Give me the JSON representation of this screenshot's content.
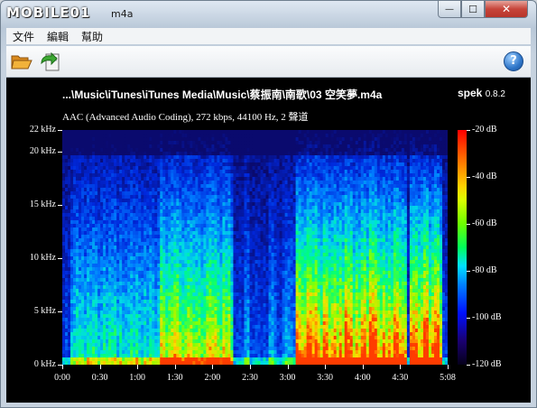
{
  "window": {
    "title_logo": "MOBILE01",
    "title": "m4a",
    "min_glyph": "—",
    "max_glyph": "☐",
    "close_glyph": "✕"
  },
  "menu": [
    "文件",
    "編輯",
    "幫助"
  ],
  "toolbar": {
    "open_icon": "folder-open-icon",
    "save_icon": "save-export-icon",
    "help_icon": "help-icon",
    "help_glyph": "?"
  },
  "spek": {
    "file_path": "...\\Music\\iTunes\\iTunes Media\\Music\\蔡振南\\南歌\\03 空笑夢.m4a",
    "app_name": "spek",
    "version": "0.8.2",
    "file_info": "AAC (Advanced Audio Coding), 272 kbps, 44100 Hz, 2 聲道"
  },
  "chart_data": {
    "type": "heatmap",
    "x_ticks": [
      "0:00",
      "0:30",
      "1:00",
      "1:30",
      "2:00",
      "2:30",
      "3:00",
      "3:30",
      "4:00",
      "4:30",
      "5:08"
    ],
    "x_values_sec": [
      0,
      30,
      60,
      90,
      120,
      150,
      180,
      210,
      240,
      270,
      308
    ],
    "x_range_sec": [
      0,
      308
    ],
    "y_ticks": [
      "0 kHz",
      "5 kHz",
      "10 kHz",
      "15 kHz",
      "20 kHz",
      "22 kHz"
    ],
    "y_values_khz": [
      0,
      5,
      10,
      15,
      20,
      22
    ],
    "y_range_khz": [
      0,
      22
    ],
    "colorbar_ticks": [
      "-20 dB",
      "-40 dB",
      "-60 dB",
      "-80 dB",
      "-100 dB",
      "-120 dB"
    ],
    "colorbar_values_db": [
      -20,
      -40,
      -60,
      -80,
      -100,
      -120
    ],
    "colorbar_range_db": [
      -120,
      -20
    ]
  }
}
